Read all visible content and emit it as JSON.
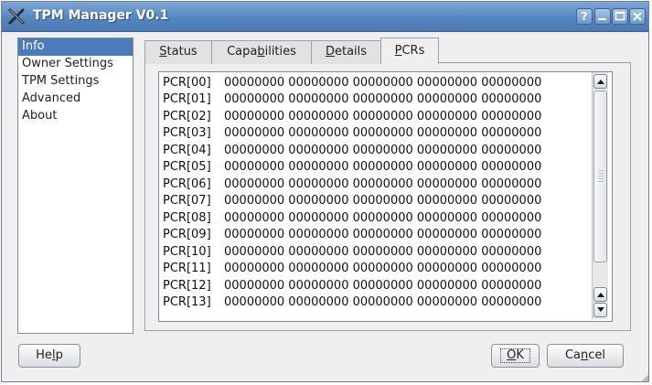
{
  "window": {
    "title": "TPM Manager V0.1",
    "help_btn": "?"
  },
  "sidebar": {
    "items": [
      {
        "label": "Info",
        "selected": true
      },
      {
        "label": "Owner Settings"
      },
      {
        "label": "TPM Settings"
      },
      {
        "label": "Advanced"
      },
      {
        "label": "About"
      }
    ]
  },
  "tabs": [
    {
      "pre": "",
      "ul": "S",
      "post": "tatus"
    },
    {
      "pre": "Capa",
      "ul": "b",
      "post": "ilities"
    },
    {
      "pre": "",
      "ul": "D",
      "post": "etails"
    },
    {
      "pre": "",
      "ul": "P",
      "post": "CRs",
      "active": true
    }
  ],
  "pcrs": [
    {
      "label": "PCR[00]",
      "value": "00000000 00000000 00000000 00000000 00000000"
    },
    {
      "label": "PCR[01]",
      "value": "00000000 00000000 00000000 00000000 00000000"
    },
    {
      "label": "PCR[02]",
      "value": "00000000 00000000 00000000 00000000 00000000"
    },
    {
      "label": "PCR[03]",
      "value": "00000000 00000000 00000000 00000000 00000000"
    },
    {
      "label": "PCR[04]",
      "value": "00000000 00000000 00000000 00000000 00000000"
    },
    {
      "label": "PCR[05]",
      "value": "00000000 00000000 00000000 00000000 00000000"
    },
    {
      "label": "PCR[06]",
      "value": "00000000 00000000 00000000 00000000 00000000"
    },
    {
      "label": "PCR[07]",
      "value": "00000000 00000000 00000000 00000000 00000000"
    },
    {
      "label": "PCR[08]",
      "value": "00000000 00000000 00000000 00000000 00000000"
    },
    {
      "label": "PCR[09]",
      "value": "00000000 00000000 00000000 00000000 00000000"
    },
    {
      "label": "PCR[10]",
      "value": "00000000 00000000 00000000 00000000 00000000"
    },
    {
      "label": "PCR[11]",
      "value": "00000000 00000000 00000000 00000000 00000000"
    },
    {
      "label": "PCR[12]",
      "value": "00000000 00000000 00000000 00000000 00000000"
    },
    {
      "label": "PCR[13]",
      "value": "00000000 00000000 00000000 00000000 00000000"
    }
  ],
  "buttons": {
    "help": {
      "pre": "He",
      "ul": "l",
      "post": "p"
    },
    "ok": {
      "pre": "",
      "ul": "O",
      "post": "K"
    },
    "cancel": {
      "pre": "Ca",
      "ul": "n",
      "post": "cel"
    }
  },
  "icons": {
    "app": "x-app-icon",
    "help": "question-icon",
    "minimize": "minimize-icon",
    "maximize": "maximize-icon",
    "close": "close-icon",
    "scroll_up": "arrow-up-icon",
    "scroll_down": "arrow-down-icon"
  },
  "colors": {
    "titlebar": "#5686c0",
    "selection": "#4d7ab8",
    "window_bg": "#efefef"
  }
}
